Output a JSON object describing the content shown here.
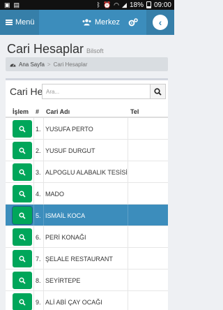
{
  "statusbar": {
    "battery": "18%",
    "time": "09:00"
  },
  "appbar": {
    "menu_label": "Menü",
    "merkez_label": "Merkez"
  },
  "page": {
    "title": "Cari Hesaplar",
    "subtitle": "Bilsoft"
  },
  "breadcrumb": {
    "home": "Ana Sayfa",
    "current": "Cari Hesaplar"
  },
  "box": {
    "title": "Cari Hesaplar",
    "search_placeholder": "Ara..."
  },
  "table": {
    "headers": {
      "action": "İşlem",
      "no": "#",
      "name": "Cari Adı",
      "tel": "Tel"
    },
    "rows": [
      {
        "no": "1.",
        "name": "YUSUFA PERTO",
        "tel": ""
      },
      {
        "no": "2.",
        "name": "YUSUF DURGUT",
        "tel": ""
      },
      {
        "no": "3.",
        "name": "ALPOGLU ALABALIK TESİSİ",
        "tel": ""
      },
      {
        "no": "4.",
        "name": "MADO",
        "tel": ""
      },
      {
        "no": "5.",
        "name": "ISMAİL KOCA",
        "tel": "",
        "selected": true
      },
      {
        "no": "6.",
        "name": "PERİ KONAĞI",
        "tel": ""
      },
      {
        "no": "7.",
        "name": "ŞELALE RESTAURANT",
        "tel": ""
      },
      {
        "no": "8.",
        "name": "SEYİRTEPE",
        "tel": ""
      },
      {
        "no": "9.",
        "name": "ALİ ABİ ÇAY OCAĞI",
        "tel": ""
      }
    ]
  },
  "colors": {
    "primary": "#3c8dbc",
    "primary_dark": "#367fa9",
    "success": "#00a65a"
  }
}
